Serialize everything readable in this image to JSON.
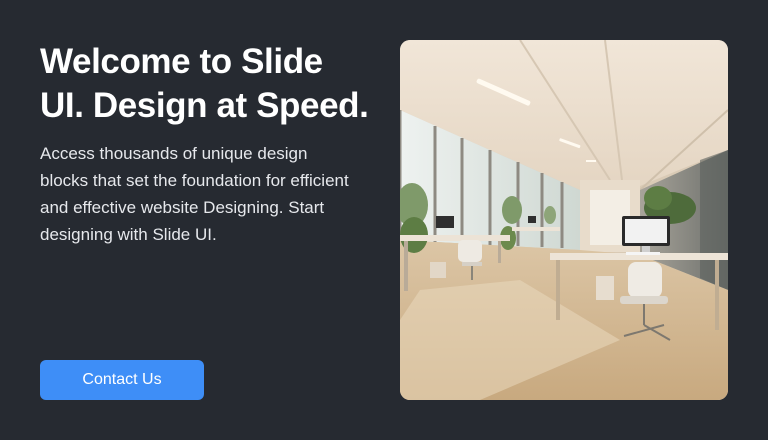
{
  "hero": {
    "title": "Welcome to Slide UI. Design at Speed.",
    "description": "Access thousands of unique design blocks that set the foundation for efficient and effective website Designing. Start designing with Slide UI.",
    "cta_label": "Contact Us"
  },
  "colors": {
    "background": "#262a31",
    "accent": "#3e8ef7",
    "text": "#ffffff"
  }
}
